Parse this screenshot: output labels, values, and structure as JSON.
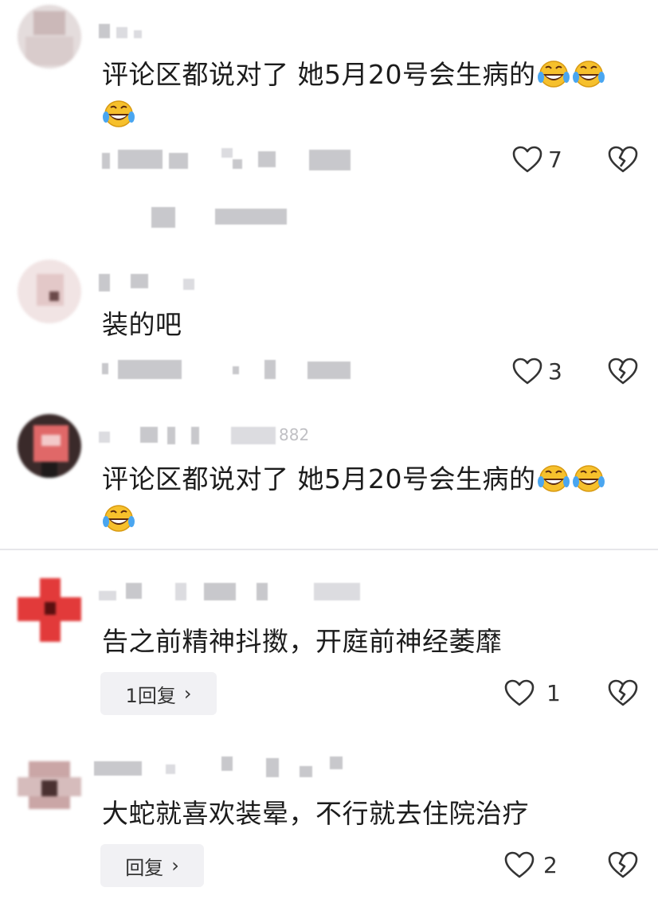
{
  "comments": [
    {
      "text": "评论区都说对了 她5月20号会生病的",
      "likes": "7",
      "emoji": "rolling-on-floor-laughing-emoji"
    },
    {
      "text": "装的吧",
      "likes": "3"
    },
    {
      "text": "评论区都说对了 她5月20号会生病的",
      "emoji": "rolling-on-floor-laughing-emoji",
      "partial_name_visible": "882"
    },
    {
      "text": "告之前精神抖擞，开庭前神经萎靡",
      "likes": "1",
      "reply_label": "1回复"
    },
    {
      "text": "大蛇就喜欢装晕，不行就去住院治疗",
      "likes": "2",
      "reply_label": "回复"
    }
  ],
  "icons": {
    "like": "heart-outline-icon",
    "dislike": "broken-heart-icon",
    "chevron": "chevron-right-icon"
  },
  "colors": {
    "background": "#ffffff",
    "text": "#1c1c1c",
    "reply_bg": "#f1f1f4",
    "divider": "#e6e6ea"
  }
}
